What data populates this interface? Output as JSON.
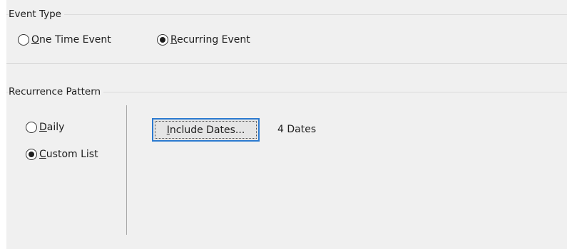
{
  "event_type": {
    "title": "Event Type",
    "one_time": {
      "label": "One Time Event",
      "mnemonic": "O",
      "rest": "ne Time Event",
      "checked": false
    },
    "recurring": {
      "label": "Recurring Event",
      "mnemonic": "R",
      "rest": "ecurring Event",
      "checked": true
    }
  },
  "recurrence": {
    "title": "Recurrence Pattern",
    "daily": {
      "label": "Daily",
      "mnemonic": "D",
      "rest": "aily",
      "checked": false
    },
    "custom_list": {
      "label": "Custom List",
      "mnemonic": "C",
      "rest": "ustom List",
      "checked": true
    },
    "include_dates_button": {
      "label": "Include Dates...",
      "mnemonic": "I",
      "rest": "nclude Dates..."
    },
    "dates_count": "4 Dates"
  },
  "colors": {
    "panel_bg": "#f0f0f0",
    "focus_border": "#2b7ad0"
  }
}
